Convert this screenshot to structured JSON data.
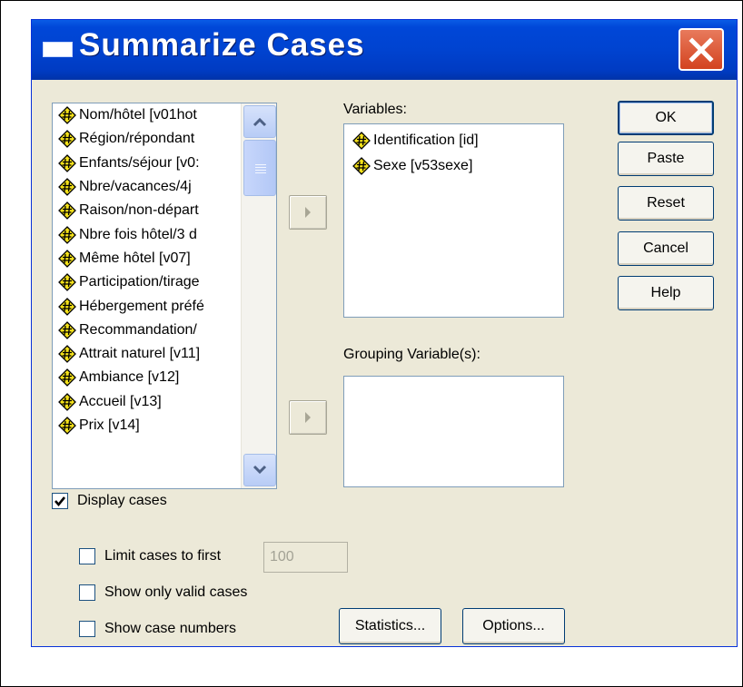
{
  "dialog": {
    "title": "Summarize Cases"
  },
  "source_list": {
    "items": [
      "Nom/hôtel [v01hot",
      "Région/répondant",
      "Enfants/séjour [v0:",
      "Nbre/vacances/4j",
      "Raison/non-départ",
      "Nbre fois hôtel/3 d",
      "Même hôtel [v07]",
      "Participation/tirage",
      "Hébergement préfé",
      "Recommandation/",
      "Attrait naturel [v11]",
      "Ambiance [v12]",
      "Accueil [v13]",
      "Prix [v14]"
    ]
  },
  "variables": {
    "label": "Variables:",
    "items": [
      "Identification [id]",
      "Sexe [v53sexe]"
    ]
  },
  "grouping": {
    "label": "Grouping Variable(s):"
  },
  "buttons": {
    "ok": "OK",
    "paste": "Paste",
    "reset": "Reset",
    "cancel": "Cancel",
    "help": "Help",
    "statistics": "Statistics...",
    "options": "Options..."
  },
  "options": {
    "display_cases": {
      "label": "Display cases",
      "checked": true
    },
    "limit_cases": {
      "label": "Limit cases to first",
      "checked": false,
      "value": "100"
    },
    "valid_cases": {
      "label": "Show only valid cases",
      "checked": false
    },
    "case_numbers": {
      "label": "Show case numbers",
      "checked": false
    }
  },
  "icons": {
    "variable": "numeric-variable-icon",
    "move": "right-arrow-icon",
    "close": "close-icon"
  },
  "colors": {
    "titlebar": "#0047d8",
    "close": "#d34320",
    "dialog_bg": "#ece9d8",
    "icon_diamond": "#f5e21a"
  }
}
